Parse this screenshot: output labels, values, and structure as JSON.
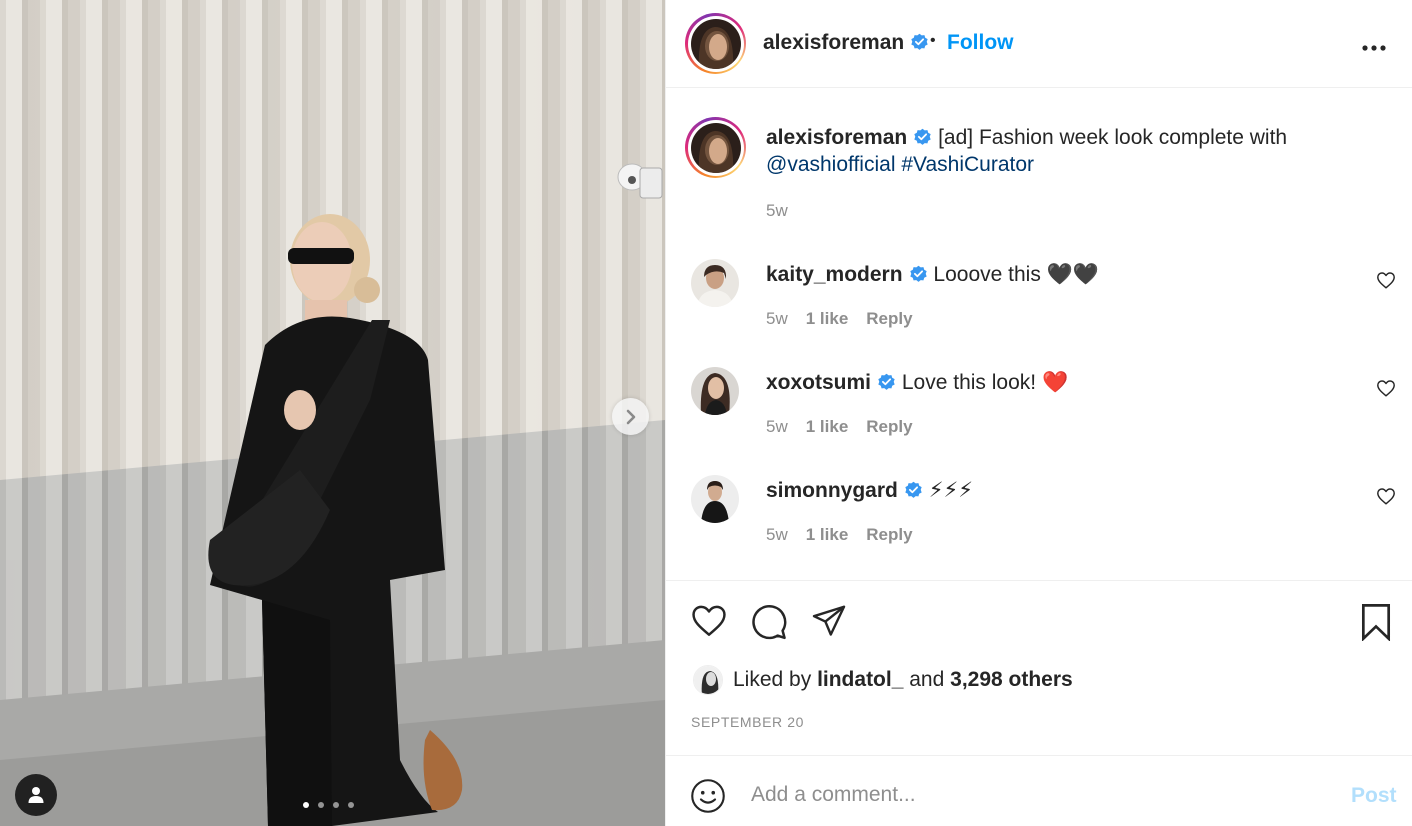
{
  "post": {
    "author": "alexisforeman",
    "bullet": "•",
    "follow_label": "Follow",
    "more_label": "•••",
    "carousel": {
      "slides": 4,
      "active": 1
    }
  },
  "caption": {
    "username": "alexisforeman",
    "text": "[ad] Fashion week look complete with",
    "mention": "@vashiofficial",
    "hashtag": "#VashiCurator",
    "time": "5w"
  },
  "comments": [
    {
      "username": "kaity_modern",
      "text": "Looove this 🖤🖤",
      "time": "5w",
      "likes": "1 like",
      "reply": "Reply"
    },
    {
      "username": "xoxotsumi",
      "text": "Love this look! ❤️",
      "time": "5w",
      "likes": "1 like",
      "reply": "Reply"
    },
    {
      "username": "simonnygard",
      "text": "⚡⚡⚡",
      "time": "5w",
      "likes": "1 like",
      "reply": "Reply"
    }
  ],
  "likes": {
    "prefix": "Liked by",
    "user": "lindatol_",
    "joiner": "and",
    "others": "3,298 others"
  },
  "date": "SEPTEMBER 20",
  "compose": {
    "placeholder": "Add a comment...",
    "post_label": "Post"
  },
  "colors": {
    "link_blue": "#0095f6",
    "mention_blue": "#00376b",
    "verified_blue": "#3897f0",
    "muted": "#8e8e8e",
    "post_disabled": "#b2dffc"
  }
}
